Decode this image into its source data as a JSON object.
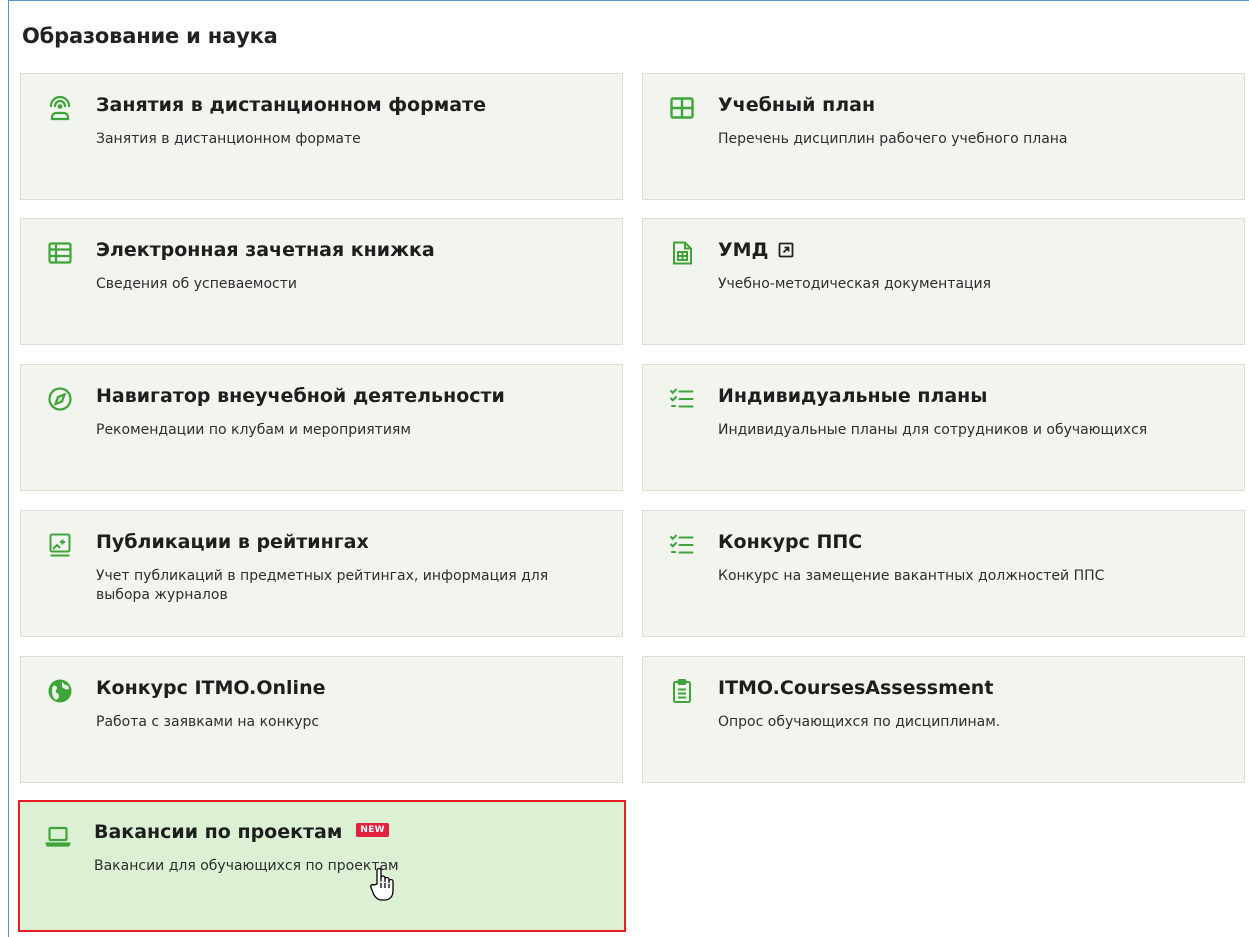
{
  "section": {
    "title": "Образование и наука"
  },
  "cards": [
    {
      "name": "Занятия в дистанционном формате",
      "desc": "Занятия в дистанционном формате",
      "icon": "webinar-person-icon"
    },
    {
      "name": "Учебный план",
      "desc": "Перечень дисциплин рабочего учебного плана",
      "icon": "grid-table-icon"
    },
    {
      "name": "Электронная зачетная книжка",
      "desc": "Сведения об успеваемости",
      "icon": "table-list-icon"
    },
    {
      "name": "УМД",
      "desc": "Учебно-методическая документация",
      "icon": "document-spreadsheet-icon",
      "external_icon": "external-link-icon"
    },
    {
      "name": "Навигатор внеучебной деятельности",
      "desc": "Рекомендации по клубам и мероприятиям",
      "icon": "compass-icon"
    },
    {
      "name": "Индивидуальные планы",
      "desc": "Индивидуальные планы для сотрудников и обучающихся",
      "icon": "checklist-icon"
    },
    {
      "name": "Публикации в рейтингах",
      "desc": "Учет публикаций в предметных рейтингах, информация для выбора журналов",
      "icon": "image-plus-icon"
    },
    {
      "name": "Конкурс ППС",
      "desc": "Конкурс на замещение вакантных должностей ППС",
      "icon": "checklist-icon"
    },
    {
      "name": "Конкурс ITMO.Online",
      "desc": "Работа с заявками на конкурс",
      "icon": "globe-icon"
    },
    {
      "name": "ITMO.CoursesAssessment",
      "desc": "Опрос обучающихся по дисциплинам.",
      "icon": "clipboard-icon"
    },
    {
      "name": "Вакансии по проектам",
      "desc": "Вакансии для обучающихся по проектам",
      "icon": "laptop-icon",
      "badge": "NEW",
      "highlighted": true
    }
  ],
  "colors": {
    "accent": "#3fa53a",
    "card_bg": "#f1f5ee",
    "highlight_bg": "#dcf1d4",
    "highlight_border": "#ea1c24",
    "badge": "#e3213d"
  }
}
